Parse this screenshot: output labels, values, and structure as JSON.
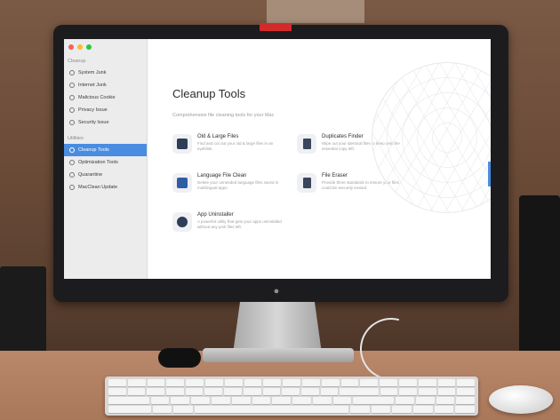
{
  "sidebar": {
    "section1": "Cleanup",
    "items1": [
      {
        "label": "System Junk",
        "icon": "trash-icon"
      },
      {
        "label": "Internet Junk",
        "icon": "globe-icon"
      },
      {
        "label": "Malicious Cookie",
        "icon": "cookie-icon"
      },
      {
        "label": "Privacy Issue",
        "icon": "eye-icon"
      },
      {
        "label": "Security Issue",
        "icon": "shield-icon"
      }
    ],
    "section2": "Utilities",
    "items2": [
      {
        "label": "Cleanup Tools",
        "icon": "tools-icon",
        "active": true
      },
      {
        "label": "Optimization Tools",
        "icon": "rocket-icon"
      },
      {
        "label": "Quarantine",
        "icon": "box-icon"
      },
      {
        "label": "MacClean Update",
        "icon": "refresh-icon"
      }
    ]
  },
  "main": {
    "title": "Cleanup Tools",
    "subtitle": "Comprehensive file cleaning tools for your Mac",
    "tools": [
      {
        "name": "Old & Large Files",
        "desc": "Find and cut out your old & large files in an eyeblink.",
        "icon": "folder-icon"
      },
      {
        "name": "Duplicates Finder",
        "desc": "Wipe out your identical files to keep only the essential copy left.",
        "icon": "duplicate-icon"
      },
      {
        "name": "Language File Clean",
        "desc": "Delete your unneeded language files saved in multilingual apps.",
        "icon": "flag-icon"
      },
      {
        "name": "File Eraser",
        "desc": "Provide three standards to ensure your files could be securely erased.",
        "icon": "shredder-icon"
      },
      {
        "name": "App Uninstaller",
        "desc": "A powerful utility that gets your apps uninstalled without any junk files left.",
        "icon": "app-store-icon"
      }
    ]
  },
  "colors": {
    "accent": "#4a8de0",
    "tape": "#d32a2a"
  }
}
